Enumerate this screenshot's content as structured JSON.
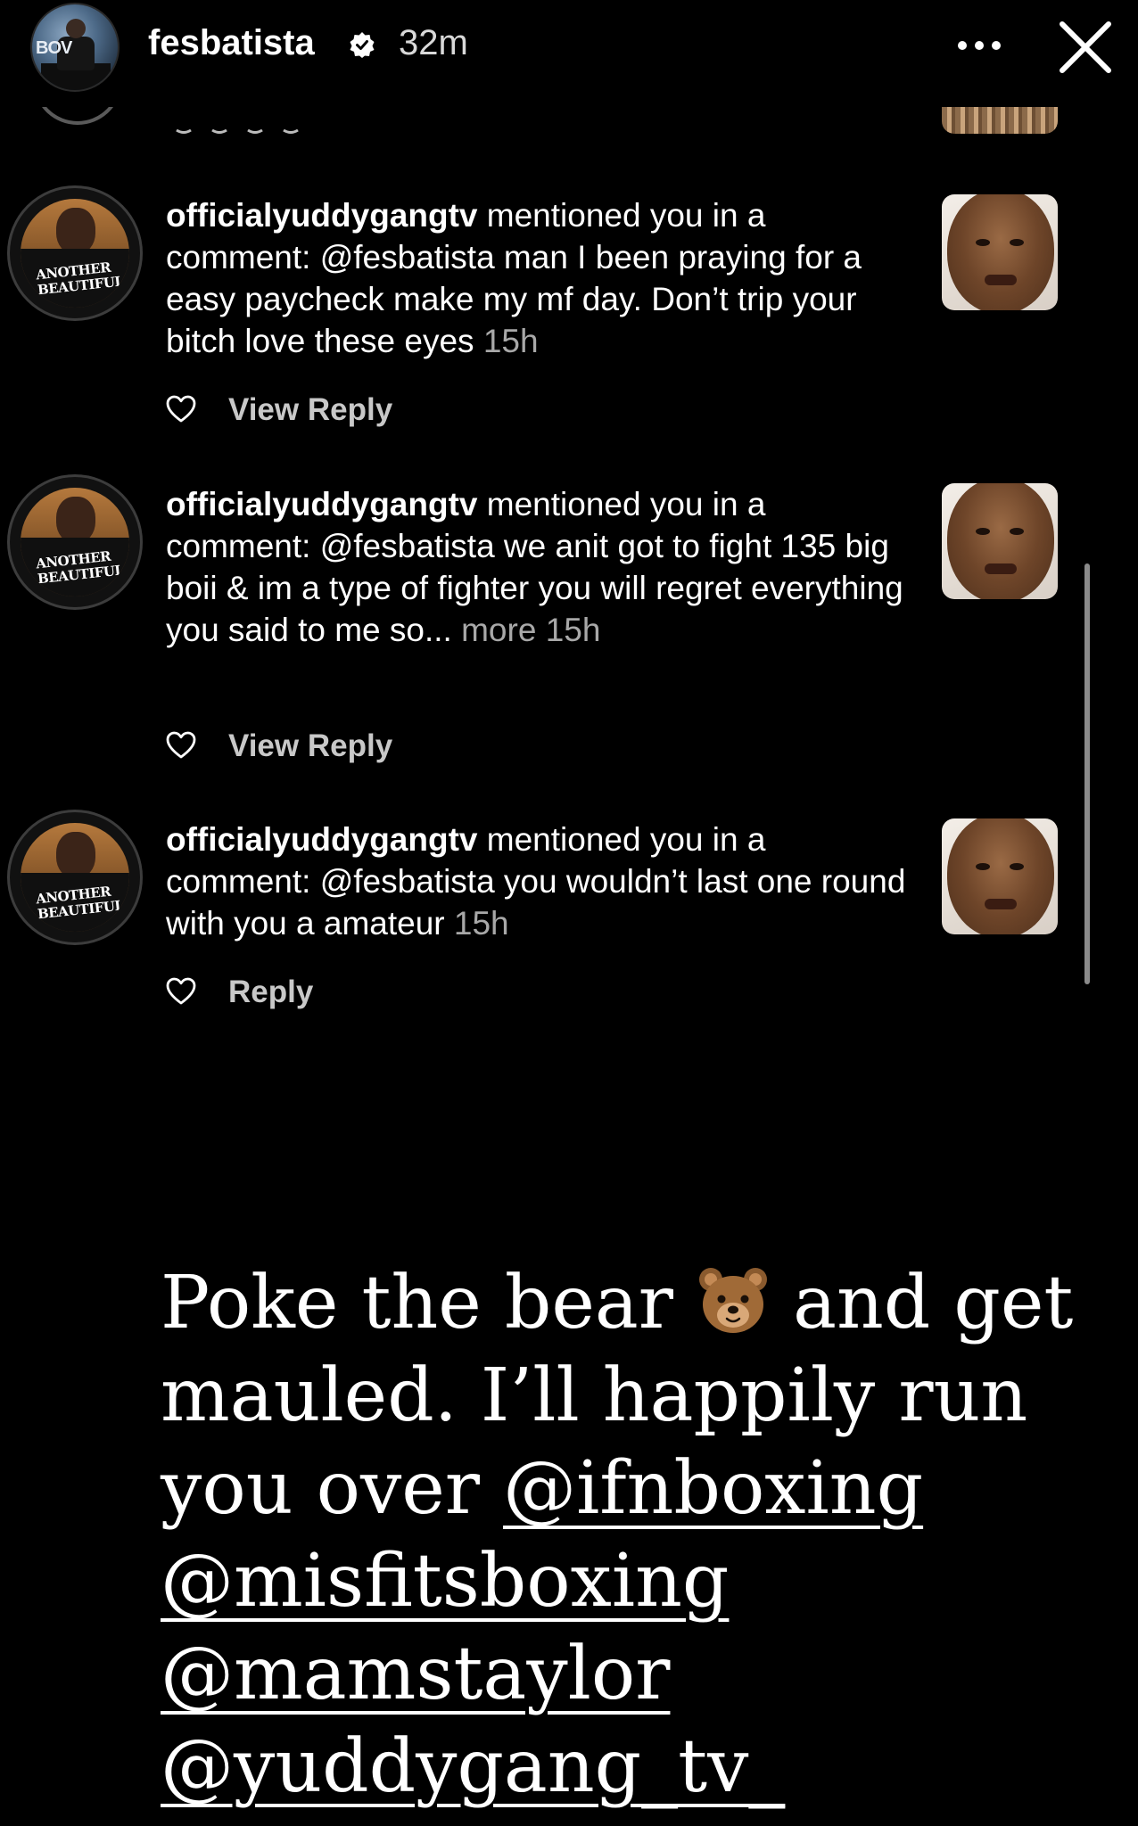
{
  "header": {
    "username": "fesbatista",
    "time": "32m",
    "avatar_logo": "BOV",
    "verified_icon": "verified-badge-icon",
    "more_icon": "more-dots-icon",
    "close_icon": "close-icon"
  },
  "notifications": [
    {
      "username": "officialyuddygangtv",
      "text": " mentioned you in a comment: @fesbatista man I been praying for a easy paycheck make my mf day. Don’t trip your bitch love these eyes ",
      "more": "",
      "time": "15h",
      "action": "View Reply",
      "avatar_shirt_text": "ANOTHER BEAUTIFUL"
    },
    {
      "username": "officialyuddygangtv",
      "text": " mentioned you in a comment: @fesbatista we anit got to fight 135 big boii & im a type of fighter you will regret everything you said  to me so... ",
      "more": "more",
      "time": "15h",
      "action": "View Reply",
      "avatar_shirt_text": "ANOTHER BEAUTIFUL"
    },
    {
      "username": "officialyuddygangtv",
      "text": " mentioned you in a comment: @fesbatista you wouldn’t last one round with you a amateur ",
      "more": "",
      "time": "15h",
      "action": "Reply",
      "avatar_shirt_text": "ANOTHER BEAUTIFUL"
    }
  ],
  "caption": {
    "line1_a": "Poke the bear ",
    "emoji_icon": "bear-face-icon",
    "line1_b": " and get mauled. I’ll happily run you over  ",
    "mentions": [
      "@ifnboxing",
      "@misfitsboxing",
      "@mamstaylor",
      "@yuddygang_tv_"
    ]
  },
  "colors": {
    "background": "#000000",
    "text": "#ffffff",
    "secondary_text": "#a8a8a8"
  }
}
